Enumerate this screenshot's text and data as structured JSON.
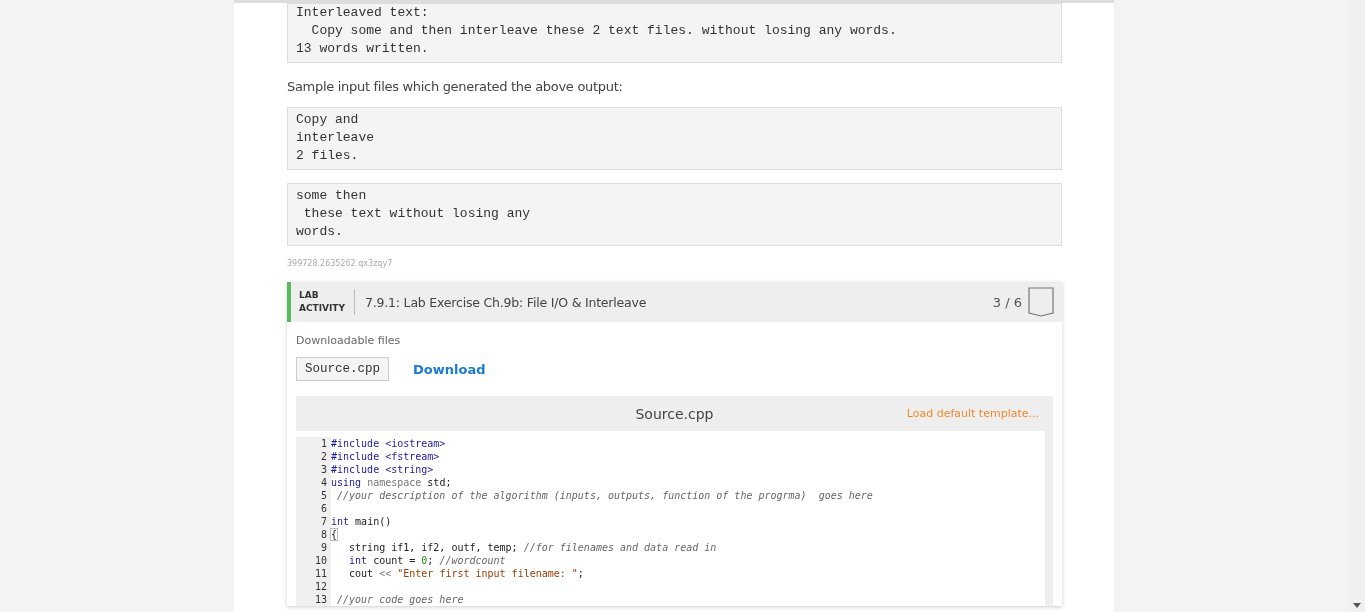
{
  "output_box": {
    "lines": [
      "Interleaved text:",
      "  Copy some and then interleave these 2 text files. without losing any words.",
      "13 words written."
    ]
  },
  "sample_caption": "Sample input files which generated the above output:",
  "input_files": [
    {
      "lines": [
        "Copy and",
        "interleave",
        "2 files."
      ]
    },
    {
      "lines": [
        "some then",
        " these text without losing any",
        "words."
      ]
    }
  ],
  "section_id": "399728.2635262.qx3zqy7",
  "lab": {
    "badge_top": "LAB",
    "badge_bottom": "ACTIVITY",
    "title": "7.9.1: Lab Exercise Ch.9b: File I/O & Interleave",
    "score": "3 / 6",
    "downloads_label": "Downloadable files",
    "file_name": "Source.cpp",
    "download_link": "Download",
    "editor": {
      "filename": "Source.cpp",
      "load_template": "Load default template...",
      "lines": [
        {
          "number": "1",
          "tokens": [
            {
              "kind": "keyword",
              "text": "#include "
            },
            {
              "kind": "include",
              "text": "<iostream>"
            }
          ]
        },
        {
          "number": "2",
          "tokens": [
            {
              "kind": "keyword",
              "text": "#include "
            },
            {
              "kind": "include",
              "text": "<fstream>"
            }
          ]
        },
        {
          "number": "3",
          "tokens": [
            {
              "kind": "keyword",
              "text": "#include "
            },
            {
              "kind": "include",
              "text": "<string>"
            }
          ]
        },
        {
          "number": "4",
          "tokens": [
            {
              "kind": "keyword",
              "text": "using "
            },
            {
              "kind": "muted",
              "text": "namespace "
            },
            {
              "kind": "plain",
              "text": "std;"
            }
          ]
        },
        {
          "number": "5",
          "tokens": [
            {
              "kind": "comment",
              "text": " //your description of the algorithm (inputs, outputs, function of the progrma)  goes here"
            }
          ]
        },
        {
          "number": "6"
        },
        {
          "number": "7",
          "tokens": [
            {
              "kind": "keyword",
              "text": "int "
            },
            {
              "kind": "plain",
              "text": "main()"
            }
          ]
        },
        {
          "number": "8",
          "tokens": [
            {
              "kind": "bracket",
              "text": "{"
            }
          ]
        },
        {
          "number": "9",
          "tokens": [
            {
              "kind": "plain",
              "text": "   string if1, if2, outf, temp; "
            },
            {
              "kind": "comment",
              "text": "//for filenames and data read in"
            }
          ]
        },
        {
          "number": "10",
          "tokens": [
            {
              "kind": "keyword",
              "text": "   int "
            },
            {
              "kind": "plain",
              "text": "count = "
            },
            {
              "kind": "number",
              "text": "0"
            },
            {
              "kind": "plain",
              "text": "; "
            },
            {
              "kind": "comment",
              "text": "//wordcount"
            }
          ]
        },
        {
          "number": "11",
          "tokens": [
            {
              "kind": "plain",
              "text": "   cout "
            },
            {
              "kind": "muted",
              "text": "<< "
            },
            {
              "kind": "string",
              "text": "\"Enter first input filename: \""
            },
            {
              "kind": "plain",
              "text": ";"
            }
          ]
        },
        {
          "number": "12"
        },
        {
          "number": "13",
          "tokens": [
            {
              "kind": "comment",
              "text": " //your code goes here"
            }
          ]
        }
      ]
    }
  }
}
